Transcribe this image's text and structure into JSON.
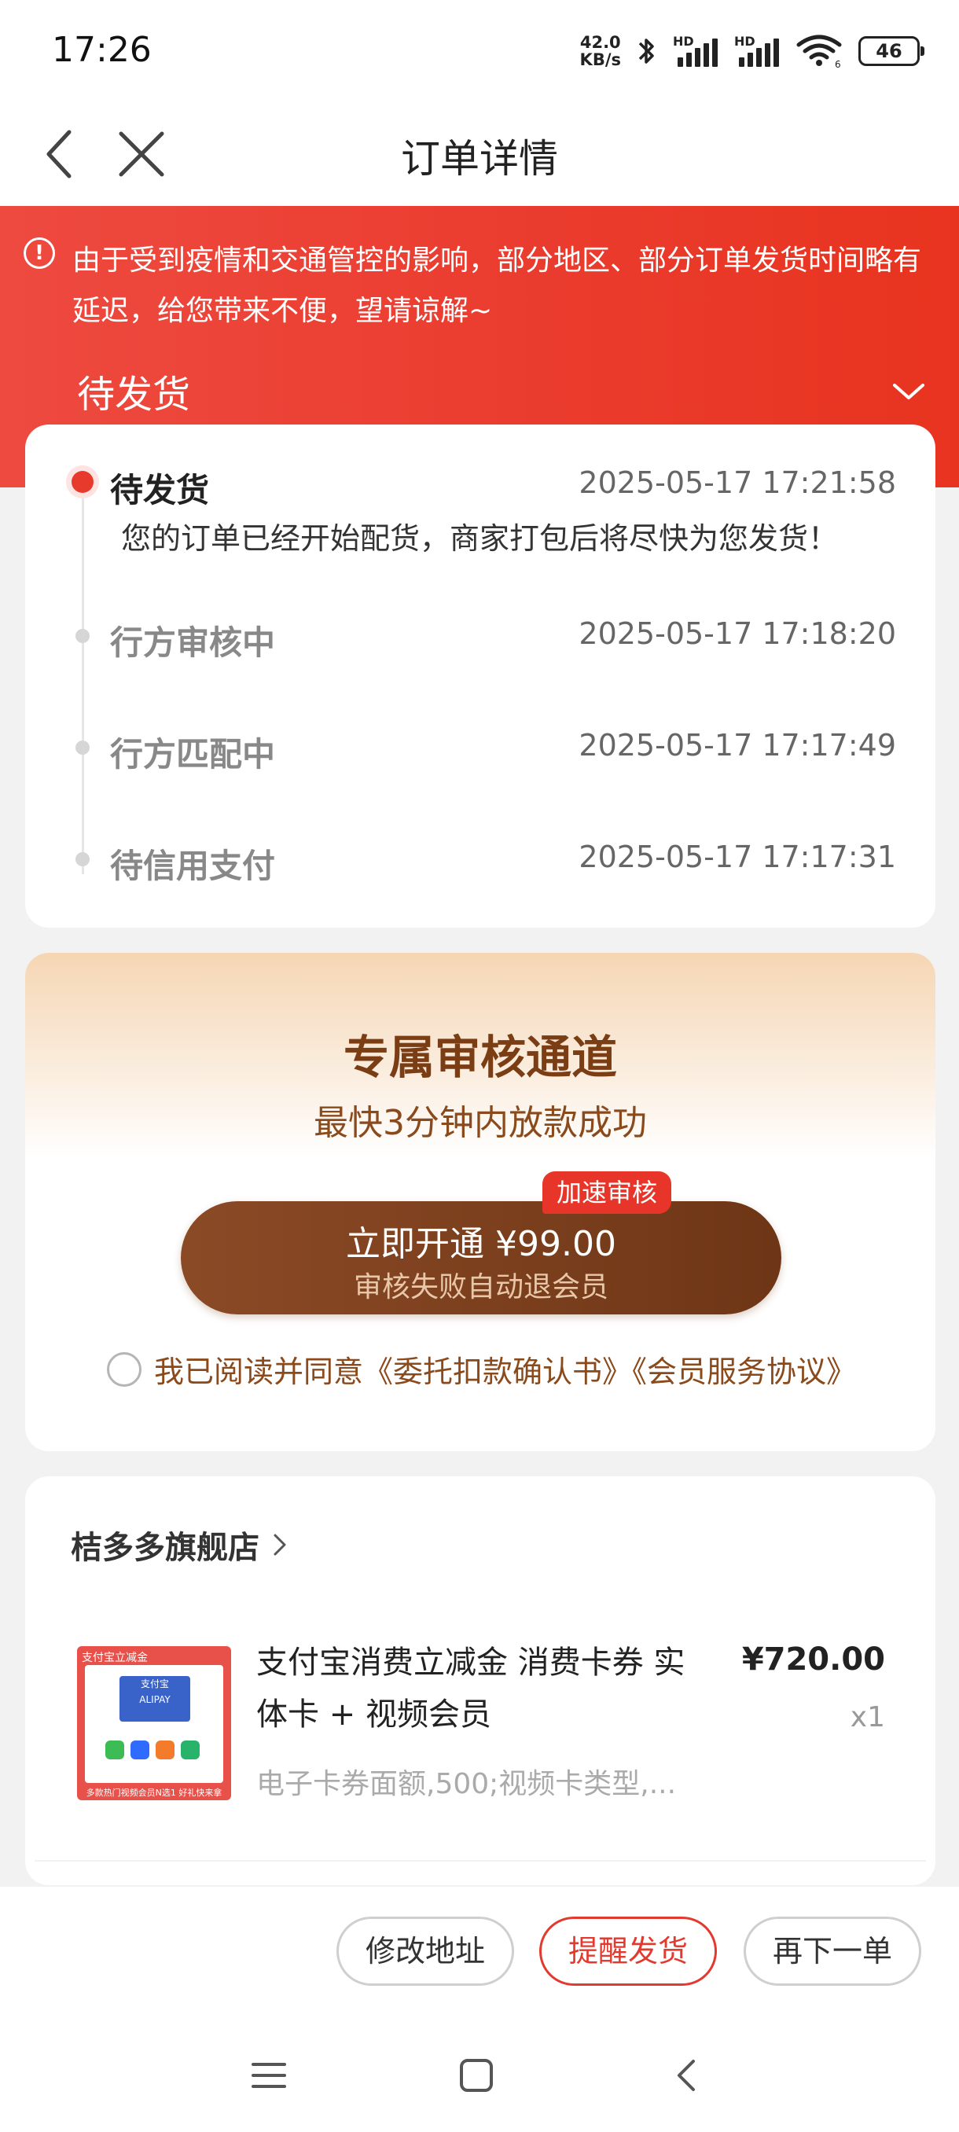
{
  "status_bar": {
    "time": "17:26",
    "net_speed_value": "42.0",
    "net_speed_unit": "KB/s",
    "sim1_label": "HD",
    "sim2_label": "HD",
    "wifi_badge": "6",
    "battery": "46"
  },
  "nav": {
    "title": "订单详情"
  },
  "header": {
    "notice": "由于受到疫情和交通管控的影响，部分地区、部分订单发货时间略有延迟，给您带来不便，望请谅解~",
    "status": "待发货"
  },
  "timeline": [
    {
      "title": "待发货",
      "time": "2025-05-17 17:21:58",
      "desc": "您的订单已经开始配货，商家打包后将尽快为您发货！"
    },
    {
      "title": "行方审核中",
      "time": "2025-05-17 17:18:20"
    },
    {
      "title": "行方匹配中",
      "time": "2025-05-17 17:17:49"
    },
    {
      "title": "待信用支付",
      "time": "2025-05-17 17:17:31"
    }
  ],
  "promo": {
    "title": "专属审核通道",
    "subtitle": "最快3分钟内放款成功",
    "badge": "加速审核",
    "button_label": "立即开通 ¥99.00",
    "button_sub": "审核失败自动退会员",
    "agreement": "我已阅读并同意《委托扣款确认书》《会员服务协议》"
  },
  "order": {
    "shop_name": "桔多多旗舰店",
    "product": {
      "title": "支付宝消费立减金 消费卡券 实体卡 + 视频会员",
      "price": "¥720.00",
      "qty": "x1",
      "spec": "电子卡券面额,500;视频卡类型,...",
      "image_top_text": "支付宝立减金",
      "image_card_text": "支付宝",
      "image_card_sub": "ALIPAY",
      "image_bottom_text": "多款热门视频会员N选1 好礼快来拿"
    }
  },
  "actions": {
    "edit_address": "修改地址",
    "remind_ship": "提醒发货",
    "reorder": "再下一单"
  },
  "colors": {
    "accent_red": "#e83a2c",
    "promo_brown": "#7a3d14"
  }
}
